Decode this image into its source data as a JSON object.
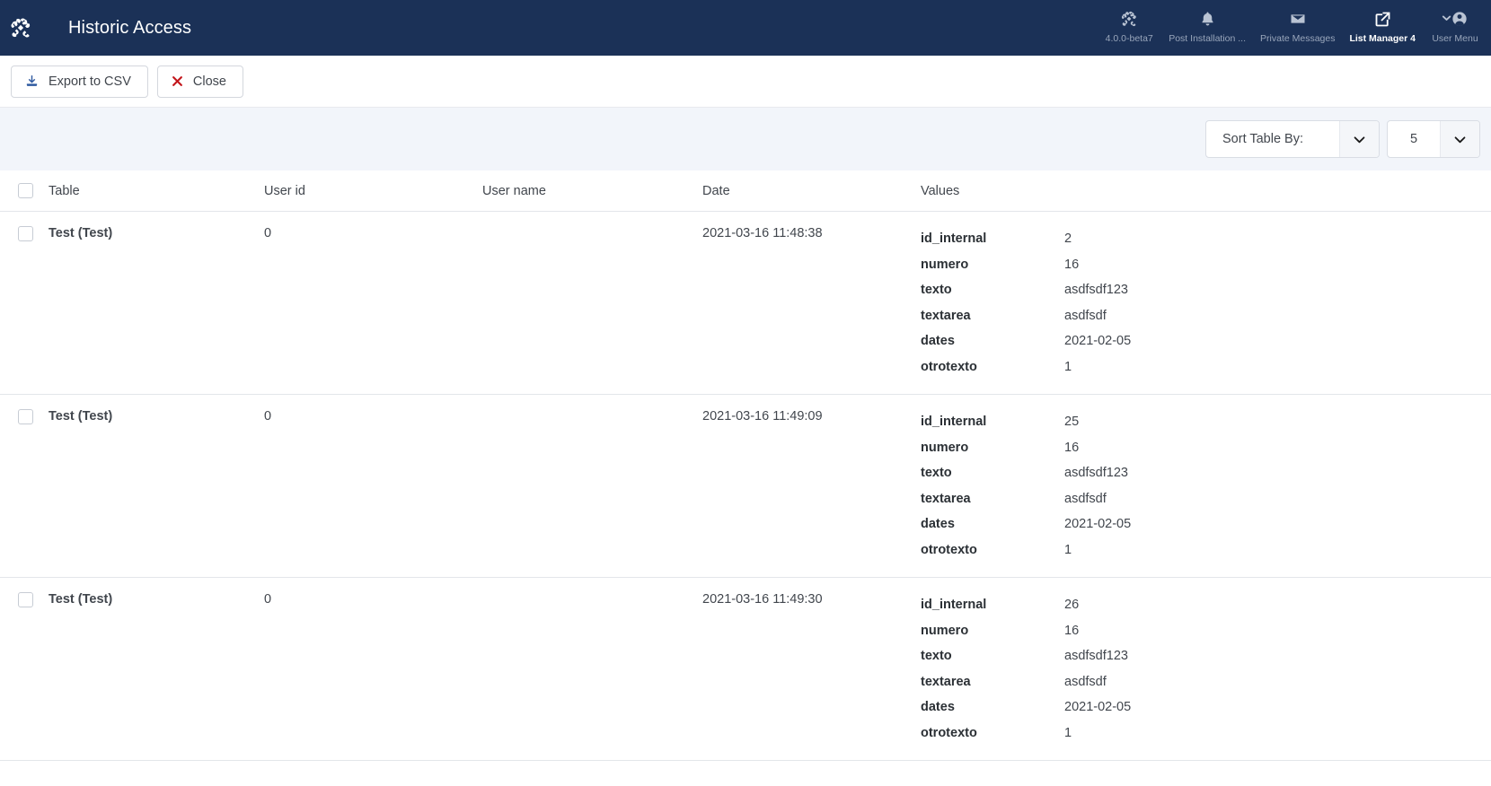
{
  "header": {
    "title": "Historic Access",
    "logo_icon": "joomla-logo-icon",
    "tools": [
      {
        "icon": "joomla-version-icon",
        "label": "4.0.0-beta7",
        "active": false
      },
      {
        "icon": "bell-icon",
        "label": "Post Installation ...",
        "active": false
      },
      {
        "icon": "envelope-icon",
        "label": "Private Messages",
        "active": false
      },
      {
        "icon": "external-link-icon",
        "label": "List Manager 4",
        "active": true
      },
      {
        "icon": "user-circle-icon",
        "label": "User Menu",
        "active": false
      }
    ]
  },
  "toolbar": {
    "export_label": "Export to CSV",
    "export_icon": "download-icon",
    "close_label": "Close",
    "close_icon": "x-icon"
  },
  "filterbar": {
    "sort_label": "Sort Table By:",
    "sort_icon": "chevron-down-icon",
    "limit_value": "5",
    "limit_icon": "chevron-down-icon"
  },
  "table": {
    "columns": [
      "Table",
      "User id",
      "User name",
      "Date",
      "Values"
    ],
    "rows": [
      {
        "table": "Test (Test)",
        "user_id": "0",
        "user_name": "",
        "date": "2021-03-16 11:48:38",
        "values": [
          {
            "key": "id_internal",
            "value": "2"
          },
          {
            "key": "numero",
            "value": "16"
          },
          {
            "key": "texto",
            "value": "asdfsdf123"
          },
          {
            "key": "textarea",
            "value": "asdfsdf"
          },
          {
            "key": "dates",
            "value": "2021-02-05"
          },
          {
            "key": "otrotexto",
            "value": "1"
          }
        ]
      },
      {
        "table": "Test (Test)",
        "user_id": "0",
        "user_name": "",
        "date": "2021-03-16 11:49:09",
        "values": [
          {
            "key": "id_internal",
            "value": "25"
          },
          {
            "key": "numero",
            "value": "16"
          },
          {
            "key": "texto",
            "value": "asdfsdf123"
          },
          {
            "key": "textarea",
            "value": "asdfsdf"
          },
          {
            "key": "dates",
            "value": "2021-02-05"
          },
          {
            "key": "otrotexto",
            "value": "1"
          }
        ]
      },
      {
        "table": "Test (Test)",
        "user_id": "0",
        "user_name": "",
        "date": "2021-03-16 11:49:30",
        "values": [
          {
            "key": "id_internal",
            "value": "26"
          },
          {
            "key": "numero",
            "value": "16"
          },
          {
            "key": "texto",
            "value": "asdfsdf123"
          },
          {
            "key": "textarea",
            "value": "asdfsdf"
          },
          {
            "key": "dates",
            "value": "2021-02-05"
          },
          {
            "key": "otrotexto",
            "value": "1"
          }
        ]
      },
      {
        "table": "",
        "user_id": "",
        "user_name": "",
        "date": "",
        "values": []
      }
    ]
  },
  "colors": {
    "header_bg": "#1b3157",
    "filterbar_bg": "#f2f5fa",
    "accent_blue": "#2f5aa0",
    "close_red": "#c3161c",
    "text": "#41464d"
  }
}
